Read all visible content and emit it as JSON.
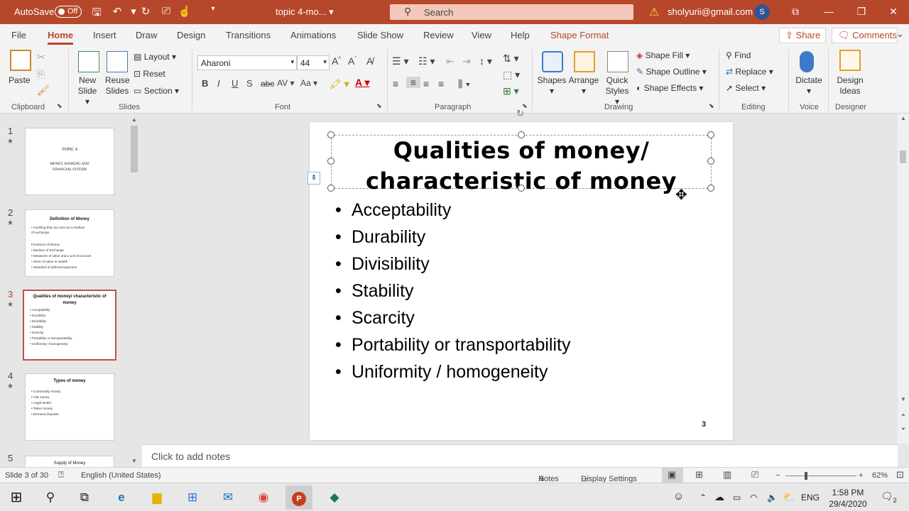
{
  "titlebar": {
    "autosave_label": "AutoSave",
    "autosave_state": "Off",
    "doc_title": "topic 4-mo...",
    "search_placeholder": "Search",
    "account_email": "sholyurii@gmail.com",
    "avatar_initial": "S"
  },
  "tabs": [
    "File",
    "Home",
    "Insert",
    "Draw",
    "Design",
    "Transitions",
    "Animations",
    "Slide Show",
    "Review",
    "View",
    "Help",
    "Shape Format"
  ],
  "active_tab": "Home",
  "share_label": "Share",
  "comments_label": "Comments",
  "ribbon": {
    "clipboard": {
      "paste": "Paste",
      "group": "Clipboard"
    },
    "slides": {
      "new_slide_1": "New",
      "new_slide_2": "Slide",
      "reuse_1": "Reuse",
      "reuse_2": "Slides",
      "layout": "Layout",
      "reset": "Reset",
      "section": "Section",
      "group": "Slides"
    },
    "font": {
      "font_name": "Aharoni",
      "font_size": "44",
      "bold": "B",
      "italic": "I",
      "underline": "U",
      "shadow": "S",
      "strike": "abc",
      "group": "Font"
    },
    "paragraph": {
      "group": "Paragraph"
    },
    "drawing": {
      "shapes": "Shapes",
      "arrange": "Arrange",
      "quick_1": "Quick",
      "quick_2": "Styles",
      "fill": "Shape Fill",
      "outline": "Shape Outline",
      "effects": "Shape Effects",
      "group": "Drawing"
    },
    "editing": {
      "find": "Find",
      "replace": "Replace",
      "select": "Select",
      "group": "Editing"
    },
    "voice": {
      "dictate": "Dictate",
      "group": "Voice"
    },
    "designer": {
      "ideas_1": "Design",
      "ideas_2": "Ideas",
      "group": "Designer"
    }
  },
  "thumbnails": [
    {
      "num": "1",
      "title": "TOPIC 4",
      "lines": [
        "MONEY, BANKING AND",
        "FINANCIAL SYSTEM"
      ]
    },
    {
      "num": "2",
      "title": "Definition of Money",
      "lines": [
        "•  Anything that can acts as a medium",
        "    of exchange.",
        "",
        "Functions of Money :",
        "•  Medium of Exchange",
        "•  Measures of value and a unit of account",
        "•  Store of value or wealth",
        "•  Standard of deferred payment"
      ]
    },
    {
      "num": "3",
      "title": "Qualities of money/ characteristic of money",
      "lines": [
        "•  Acceptability",
        "•  Durability",
        "•  Divisibility",
        "•  Stability",
        "•  Scarcity",
        "•  Portability or transportability",
        "•  Uniformity / homogeneity"
      ]
    },
    {
      "num": "4",
      "title": "Types of money",
      "lines": [
        "•  Commodity money",
        "•  Fiat money",
        "•  Legal tender",
        "•  Token money",
        "•  Demand deposits"
      ]
    },
    {
      "num": "5",
      "title": "Supply of Money",
      "lines": []
    }
  ],
  "slide": {
    "title_line1": "Qualities of money/",
    "title_line2": "characteristic of money",
    "bullets": [
      "Acceptability",
      "Durability",
      "Divisibility",
      "Stability",
      "Scarcity",
      "Portability or transportability",
      "Uniformity / homogeneity"
    ],
    "page_number": "3"
  },
  "notes_placeholder": "Click to add notes",
  "status": {
    "slide_info": "Slide 3 of 30",
    "language": "English (United States)",
    "notes": "Notes",
    "display_settings": "Display Settings",
    "zoom": "62%"
  },
  "taskbar": {
    "language": "ENG",
    "time": "1:58 PM",
    "date": "29/4/2020",
    "notification_count": "2"
  }
}
